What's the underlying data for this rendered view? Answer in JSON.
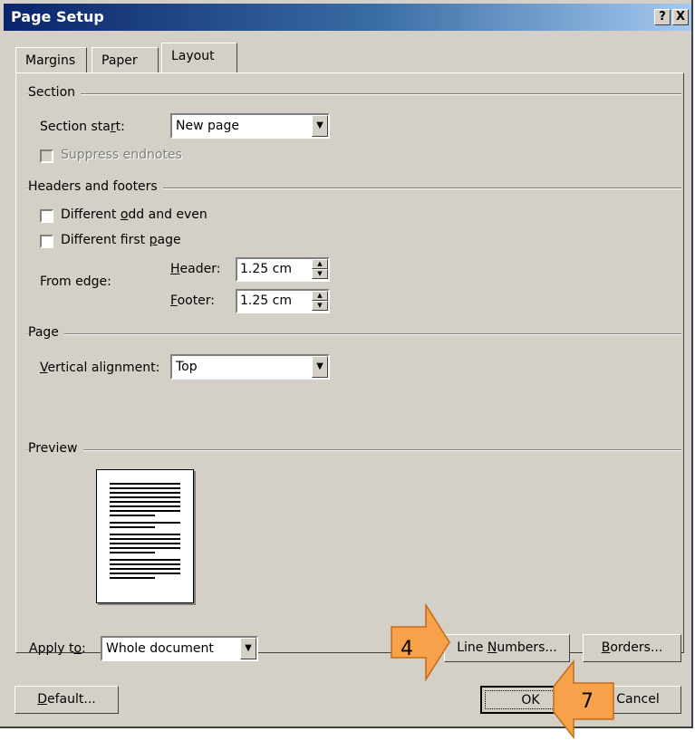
{
  "title": "Page Setup",
  "title_buttons": {
    "help": "?",
    "close": "X"
  },
  "tabs": [
    {
      "label": "Margins",
      "active": false
    },
    {
      "label": "Paper",
      "active": false
    },
    {
      "label": "Layout",
      "active": true
    }
  ],
  "section": {
    "heading": "Section",
    "start_label_pre": "Section sta",
    "start_label_u": "r",
    "start_label_post": "t:",
    "start_value": "New page",
    "suppress_endnotes": "Suppress endnotes"
  },
  "headers_footers": {
    "heading": "Headers and footers",
    "odd_even_pre": "Different ",
    "odd_even_u": "o",
    "odd_even_post": "dd and even",
    "first_page_pre": "Different first ",
    "first_page_u": "p",
    "first_page_post": "age",
    "from_edge": "From edge:",
    "header_u": "H",
    "header_post": "eader:",
    "header_value": "1.25 cm",
    "footer_u": "F",
    "footer_post": "ooter:",
    "footer_value": "1.25 cm"
  },
  "page": {
    "heading": "Page",
    "valign_u": "V",
    "valign_post": "ertical alignment:",
    "valign_value": "Top"
  },
  "preview": {
    "heading": "Preview"
  },
  "apply_to": {
    "pre": "Apply t",
    "u": "o",
    "post": ":",
    "value": "Whole document"
  },
  "buttons": {
    "line_numbers_pre": "Line ",
    "line_numbers_u": "N",
    "line_numbers_post": "umbers...",
    "borders_u": "B",
    "borders_post": "orders...",
    "default_u": "D",
    "default_post": "efault...",
    "ok": "OK",
    "cancel": "Cancel"
  },
  "callouts": {
    "step4": "4",
    "step7": "7"
  },
  "colors": {
    "callout": "#f7a24a",
    "titlebar": "#0a246a",
    "dialog": "#d4d0c8"
  }
}
